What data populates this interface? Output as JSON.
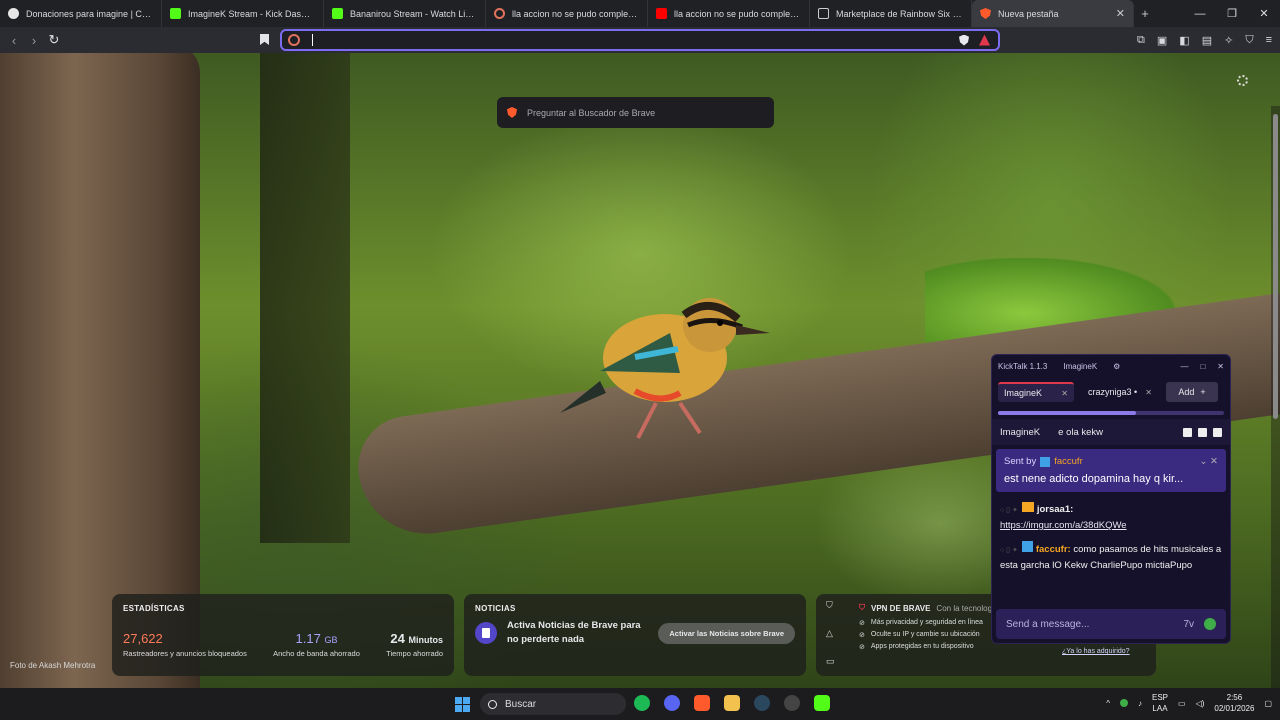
{
  "tabs": [
    {
      "label": "Donaciones para imagine | Ceneka",
      "favicon_color": "#e6e6e6"
    },
    {
      "label": "ImagineK Stream - Kick Dashboard",
      "favicon_color": "#53fc18"
    },
    {
      "label": "Bananirou Stream - Watch Live on Kick",
      "favicon_color": "#53fc18"
    },
    {
      "label": "lla accion no se pudo completar por...",
      "favicon_color": "#e2725b"
    },
    {
      "label": "lla accion no se pudo completar por...",
      "favicon_color": "#ff0000"
    },
    {
      "label": "Marketplace de Rainbow Six Siege -",
      "favicon_color": "#cccccc"
    },
    {
      "label": "Nueva pestaña",
      "favicon_color": "#ff5a2c",
      "active": true
    }
  ],
  "window_controls": {
    "minimize": "—",
    "maximize": "❐",
    "close": "✕"
  },
  "toolbar": {
    "back": "‹",
    "forward": "›",
    "reload": "↻",
    "url": ""
  },
  "search_prompt": "Preguntar al Buscador de Brave",
  "photo_credit": "Foto de Akash Mehrotra",
  "stats": {
    "title": "ESTADÍSTICAS",
    "items": [
      {
        "value": "27,622",
        "unit": "",
        "desc": "Rastreadores y anuncios bloqueados",
        "color": "#ff7a59"
      },
      {
        "value": "1.17",
        "unit": "GB",
        "desc": "Ancho de banda ahorrado",
        "color": "#a9a3ff"
      },
      {
        "value": "24",
        "unit": "Minutos",
        "desc": "Tiempo ahorrado",
        "color": "#ffffff"
      }
    ]
  },
  "news": {
    "title": "NOTICIAS",
    "text": "Activa Noticias de Brave para no perderte nada",
    "button": "Activar las Noticias sobre Brave"
  },
  "vpn": {
    "title": "VPN DE BRAVE",
    "subtitle": "Con la tecnolog",
    "features": [
      "Más privacidad y seguridad en línea",
      "Oculte su IP y cambie su ubicación",
      "Apps protegidas en tu dispositivo"
    ],
    "link": "¿Ya lo has adquirido?"
  },
  "kicktalk": {
    "app_title": "KickTalk 1.1.3",
    "user": "ImagineK",
    "tabs": [
      {
        "label": "ImagineK",
        "active": true
      },
      {
        "label": "crazyniga3 •",
        "active": false
      }
    ],
    "add_label": "Add",
    "add_icon": "+",
    "progress": 0.61,
    "channel": "ImagineK",
    "channel_status": "e ola kekw",
    "pinned": {
      "sent_by": "Sent by",
      "user": "faccufr",
      "text": "est nene adicto dopamina hay q kir..."
    },
    "messages": [
      {
        "user": "jorsaa1:",
        "user_color": "#ffffff",
        "text": "",
        "link": "https://imgur.com/a/38dKQWe"
      },
      {
        "user": "faccufr:",
        "user_color": "#f5a623",
        "text": "como pasamos de hits musicales a esta garcha lO Kekw CharliePupo mictiaPupo",
        "link": ""
      }
    ],
    "input_placeholder": "Send a message..."
  },
  "taskbar": {
    "search_label": "Buscar",
    "lang": "ESP",
    "lang_sub": "LAA",
    "time": "2:56",
    "date": "02/01/2026"
  }
}
